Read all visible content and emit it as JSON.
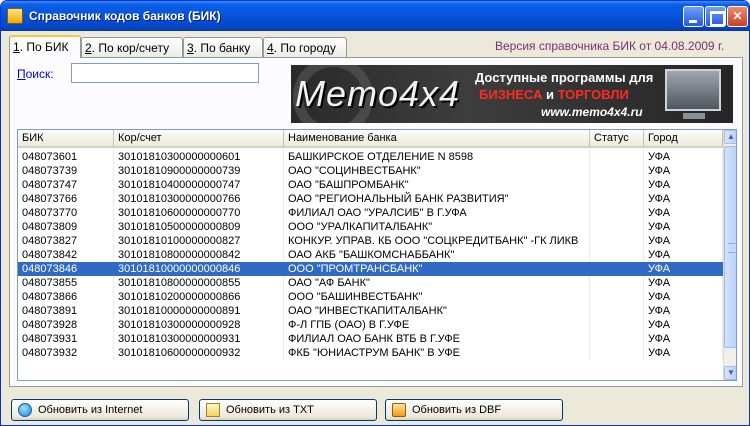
{
  "window": {
    "title": "Справочник кодов банков (БИК)"
  },
  "tabs": [
    {
      "num": "1",
      "label": ". По БИК"
    },
    {
      "num": "2",
      "label": ". По кор/счету"
    },
    {
      "num": "3",
      "label": ". По банку"
    },
    {
      "num": "4",
      "label": ". По городу"
    }
  ],
  "version_text": "Версия справочника БИК от 04.08.2009 г.",
  "search": {
    "label_first": "П",
    "label_rest": "оиск:",
    "value": ""
  },
  "banner": {
    "logo": "Memo4x4",
    "line1": "Доступные программы для",
    "line2_a": "БИЗНЕСА",
    "line2_and": " и ",
    "line2_b": "ТОРГОВЛИ",
    "line3": "www.memo4x4.ru"
  },
  "table": {
    "columns": [
      "БИК",
      "Кор/счет",
      "Наименование банка",
      "Статус",
      "Город"
    ],
    "rows": [
      [
        "048073601",
        "30101810300000000601",
        "БАШКИРСКОЕ ОТДЕЛЕНИЕ N 8598",
        "",
        "УФА"
      ],
      [
        "048073739",
        "30101810900000000739",
        "ОАО \"СОЦИНВЕСТБАНК\"",
        "",
        "УФА"
      ],
      [
        "048073747",
        "30101810400000000747",
        "ОАО \"БАШПРОМБАНК\"",
        "",
        "УФА"
      ],
      [
        "048073766",
        "30101810300000000766",
        "ОАО \"РЕГИОНАЛЬНЫЙ БАНК РАЗВИТИЯ\"",
        "",
        "УФА"
      ],
      [
        "048073770",
        "30101810600000000770",
        "ФИЛИАЛ ОАО \"УРАЛСИБ\" В Г.УФА",
        "",
        "УФА"
      ],
      [
        "048073809",
        "30101810500000000809",
        "ООО \"УРАЛКАПИТАЛБАНК\"",
        "",
        "УФА"
      ],
      [
        "048073827",
        "30101810100000000827",
        "КОНКУР. УПРАВ. КБ ООО \"СОЦКРЕДИТБАНК\" -ГК ЛИКВ",
        "",
        "УФА"
      ],
      [
        "048073842",
        "30101810800000000842",
        "ОАО АКБ \"БАШКОМСНАББАНК\"",
        "",
        "УФА"
      ],
      [
        "048073846",
        "30101810000000000846",
        "ООО \"ПРОМТРАНСБАНК\"",
        "",
        "УФА"
      ],
      [
        "048073855",
        "30101810800000000855",
        "ОАО \"АФ БАНК\"",
        "",
        "УФА"
      ],
      [
        "048073866",
        "30101810200000000866",
        "ООО \"БАШИНВЕСТБАНК\"",
        "",
        "УФА"
      ],
      [
        "048073891",
        "30101810000000000891",
        "ОАО \"ИНВЕСТКАПИТАЛБАНК\"",
        "",
        "УФА"
      ],
      [
        "048073928",
        "30101810300000000928",
        "Ф-Л ГПБ (ОАО) В Г.УФЕ",
        "",
        "УФА"
      ],
      [
        "048073931",
        "30101810300000000931",
        "ФИЛИАЛ ОАО БАНК ВТБ В Г.УФЕ",
        "",
        "УФА"
      ],
      [
        "048073932",
        "30101810600000000932",
        "ФКБ \"ЮНИАСТРУМ БАНК\" В УФЕ",
        "",
        "УФА"
      ]
    ]
  },
  "buttons": {
    "internet": "Обновить из Internet",
    "txt": "Обновить из TXT",
    "dbf": "Обновить из DBF"
  }
}
